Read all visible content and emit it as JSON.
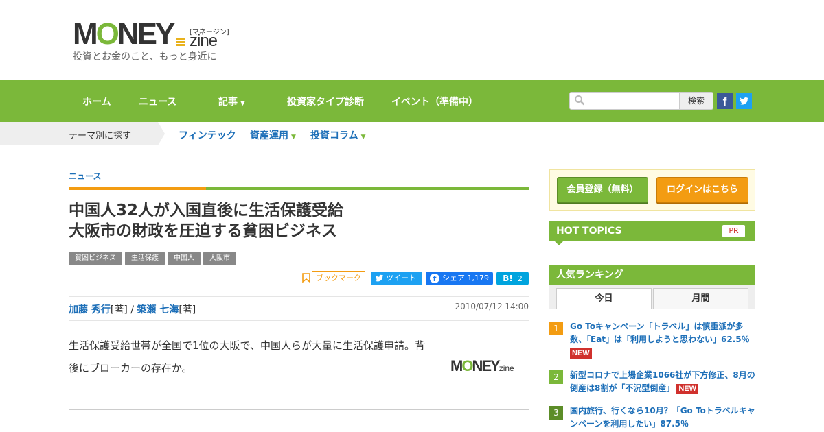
{
  "header": {
    "logo_text_prefix": "M",
    "logo_text_o": "O",
    "logo_text_suffix": "NEY",
    "logo_sub": "[マネージン]",
    "logo_zine": "zine",
    "tagline": "投資とお金のこと、もっと身近に"
  },
  "nav": {
    "items": [
      {
        "label": "ホーム"
      },
      {
        "label": "ニュース"
      },
      {
        "label": "記事",
        "caret": "▼"
      },
      {
        "label": "投資家タイプ診断"
      },
      {
        "label": "イベント（準備中）"
      }
    ],
    "search_placeholder": "",
    "search_button": "検索",
    "sns": {
      "facebook": "f",
      "twitter_icon": "twitter-icon"
    }
  },
  "theme_bar": {
    "label": "テーマ別に探す",
    "links": [
      {
        "label": "フィンテック"
      },
      {
        "label": "資産運用",
        "caret": "▼"
      },
      {
        "label": "投資コラム",
        "caret": "▼"
      }
    ]
  },
  "article": {
    "category": "ニュース",
    "title_line1": "中国人32人が入国直後に生活保護受給",
    "title_line2": "大阪市の財政を圧迫する貧困ビジネス",
    "tags": [
      "貧困ビジネス",
      "生活保護",
      "中国人",
      "大阪市"
    ],
    "bookmark_label": "ブックマーク",
    "tweet_label": "ツイート",
    "fb_share_label": "シェア",
    "fb_count": "1,179",
    "hatena_label": "B!",
    "hatena_count": "2",
    "author1": "加藤 秀行",
    "author1_role": "[著]",
    "separator": " / ",
    "author2": "築瀬 七海",
    "author2_role": "[著]",
    "date": "2010/07/12 14:00",
    "lead_text": "生活保護受給世帯が全国で1位の大阪で、中国人らが大量に生活保護申請。背後にブローカーの存在か。"
  },
  "sidebar": {
    "register_button": "会員登録（無料）",
    "login_button": "ログインはこちら",
    "hot_topics": "HOT TOPICS",
    "pr_badge": "PR",
    "ranking_title": "人気ランキング",
    "tabs": [
      {
        "label": "今日"
      },
      {
        "label": "月間"
      }
    ],
    "ranking": [
      {
        "num": "1",
        "text": "Go Toキャンペーン「トラベル」は慎重派が多数、「Eat」は「利用しようと思わない」62.5％",
        "new_badge": "NEW",
        "color": "#f39c12"
      },
      {
        "num": "2",
        "text": "新型コロナで上場企業1066社が下方修正、8月の倒産は8割が「不況型倒産」",
        "new_badge": "NEW",
        "color": "#7bb83a"
      },
      {
        "num": "3",
        "text": "国内旅行、行くなら10月？「Go Toトラベルキャンペーンを利用したい」87.5％",
        "color": "#5c8d28"
      }
    ]
  },
  "colors": {
    "brand_green": "#7bb83a",
    "accent_orange": "#f39c12",
    "link_blue": "#1d6fb8",
    "new_red": "#d0312d"
  }
}
